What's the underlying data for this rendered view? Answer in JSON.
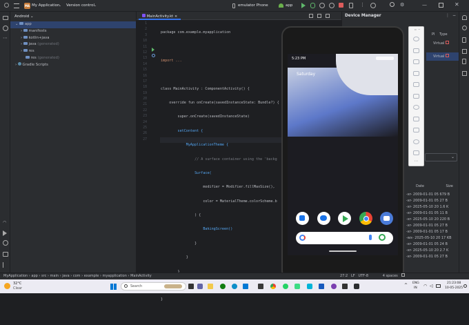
{
  "topbar": {
    "project_badge": "MA",
    "project": "My Application",
    "vcs": "Version control",
    "device": "emulator Phone",
    "run_config": "app"
  },
  "project_panel": {
    "view": "Android",
    "items": [
      {
        "label": "app",
        "depth": 0,
        "note": ""
      },
      {
        "label": "manifests",
        "depth": 1,
        "note": ""
      },
      {
        "label": "kotlin+java",
        "depth": 1,
        "note": ""
      },
      {
        "label": "java",
        "depth": 1,
        "note": "(generated)"
      },
      {
        "label": "res",
        "depth": 1,
        "note": ""
      },
      {
        "label": "res",
        "depth": 1,
        "note": "(generated)"
      },
      {
        "label": "Gradle Scripts",
        "depth": 0,
        "note": ""
      }
    ]
  },
  "editor": {
    "tab": "MainActivity.kt",
    "line_numbers": [
      "1",
      "2",
      "3",
      "10",
      "11",
      "12",
      "13",
      "14",
      "15",
      "16",
      "17",
      "18",
      "19",
      "20",
      "21",
      "22",
      "23",
      "24",
      "25",
      "26",
      "27"
    ],
    "code": [
      "package com.example.myapplication",
      "",
      "import ...",
      "",
      "class MainActivity : ComponentActivity() {",
      "    override fun onCreate(savedInstanceState: Bundle?) {",
      "        super.onCreate(savedInstanceState)",
      "        setContent {",
      "            MyApplicationTheme {",
      "                // A surface container using the 'backg",
      "                Surface(",
      "                    modifier = Modifier.fillMaxSize(),",
      "                    color = MaterialTheme.colorScheme.b",
      "                ) {",
      "                    BakingScreen()",
      "                }",
      "            }",
      "        }",
      "    }",
      "}",
      ""
    ]
  },
  "device_manager": {
    "title": "Device Manager",
    "col_api": "PI",
    "col_type": "Type",
    "devices": [
      {
        "api": "",
        "type": "Virtual"
      },
      {
        "api": "",
        "type": "Virtual"
      }
    ],
    "files_header_date": "Date",
    "files_header_size": "Size",
    "files": [
      {
        "perm": "-xr-",
        "date": "2009-01-01 05",
        "size": "679 B"
      },
      {
        "perm": "-xr-",
        "date": "2009-01-01 05",
        "size": "27 B"
      },
      {
        "perm": "-xr-",
        "date": "2025-05-10 20",
        "size": "1.6 K"
      },
      {
        "perm": "-xr-",
        "date": "2009-01-01 05",
        "size": "11 B"
      },
      {
        "perm": "-xr-",
        "date": "2025-05-10 20",
        "size": "220 B"
      },
      {
        "perm": "-xr-",
        "date": "2009-01-01 05",
        "size": "27 B"
      },
      {
        "perm": "-xr-",
        "date": "2009-01-01 05",
        "size": "17 B"
      },
      {
        "perm": "-wx-",
        "date": "2025-05-10 20",
        "size": "17 KB"
      },
      {
        "perm": "-xr-",
        "date": "2009-01-01 05",
        "size": "24 B"
      },
      {
        "perm": "-xr-",
        "date": "2025-05-10 20",
        "size": "2.7 K"
      },
      {
        "perm": "-xr-",
        "date": "2009-01-01 05",
        "size": "27 B"
      }
    ]
  },
  "phone": {
    "time": "5:23 PM",
    "date": "Saturday"
  },
  "statusbar": {
    "crumbs": [
      "MyApplication",
      "app",
      "src",
      "main",
      "java",
      "com",
      "example",
      "myapplication",
      "MainActivity"
    ],
    "position": "27:2",
    "line_sep": "LF",
    "encoding": "UTF-8",
    "indent": "4 spaces"
  },
  "taskbar": {
    "temp": "32°C",
    "weather": "Clear",
    "search_placeholder": "Search",
    "lang1": "ENG",
    "lang2": "IN",
    "time": "21:23:08",
    "date": "10-05-2025"
  }
}
